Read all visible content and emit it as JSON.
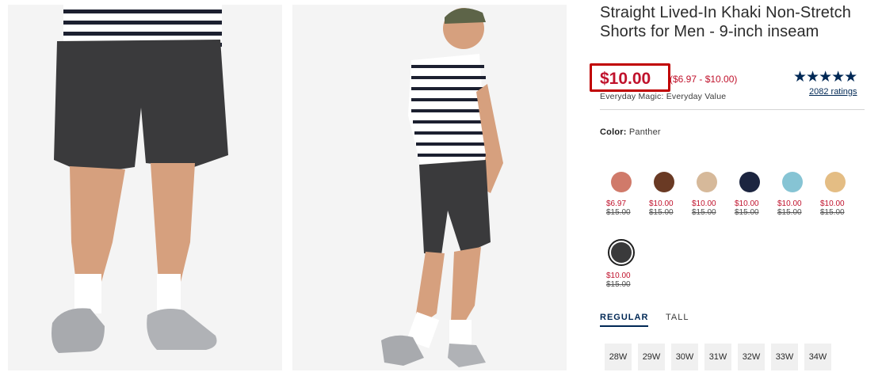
{
  "product": {
    "title": "Straight Lived-In Khaki Non-Stretch Shorts for Men - 9-inch inseam",
    "price_now": "$10.00",
    "price_range": "($6.97 - $10.00)",
    "price_note": "Everyday Magic: Everyday Value",
    "stars": "★★★★★",
    "ratings": "2082 ratings"
  },
  "color": {
    "label": "Color:",
    "value": "Panther",
    "swatches": [
      {
        "hex": "#d07a6a",
        "sale": "$6.97",
        "orig": "$15.00"
      },
      {
        "hex": "#6a3a24",
        "sale": "$10.00",
        "orig": "$15.00"
      },
      {
        "hex": "#d6b99a",
        "sale": "$10.00",
        "orig": "$15.00"
      },
      {
        "hex": "#1c2540",
        "sale": "$10.00",
        "orig": "$15.00"
      },
      {
        "hex": "#86c4d4",
        "sale": "$10.00",
        "orig": "$15.00"
      },
      {
        "hex": "#e4bd84",
        "sale": "$10.00",
        "orig": "$15.00"
      },
      {
        "hex": "#3a3a3b",
        "sale": "$10.00",
        "orig": "$15.00",
        "selected": true
      }
    ]
  },
  "fit_tabs": [
    "REGULAR",
    "TALL"
  ],
  "sizes": [
    "28W",
    "29W",
    "30W",
    "31W",
    "32W",
    "33W",
    "34W"
  ],
  "colors": {
    "sale": "#c0122c",
    "navy": "#002855",
    "highlight": "#c00000"
  }
}
